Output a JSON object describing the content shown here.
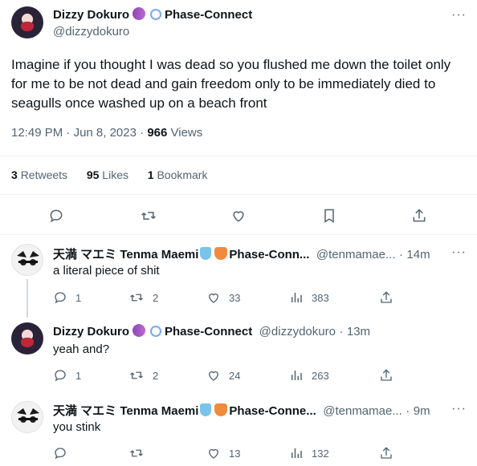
{
  "main_tweet": {
    "author_name": "Dizzy Dokuro",
    "affiliation": "Phase-Connect",
    "handle": "@dizzydokuro",
    "text": "Imagine if you thought I was dead so you flushed me down the toilet only for me to be not dead and gain freedom only to be immediately died to seagulls once washed up on a beach front",
    "time": "12:49 PM",
    "date": "Jun 8, 2023",
    "views_count": "966",
    "views_label": "Views",
    "retweets_count": "3",
    "retweets_label": "Retweets",
    "likes_count": "95",
    "likes_label": "Likes",
    "bookmarks_count": "1",
    "bookmarks_label": "Bookmark",
    "more": "···",
    "separator": "·"
  },
  "replies": [
    {
      "author_name": "天満 マエミ Tenma Maemi",
      "affiliation": "Phase-Conn...",
      "handle": "@tenmamae...",
      "time": "14m",
      "text": "a literal piece of shit",
      "replies": "1",
      "retweets": "2",
      "likes": "33",
      "views": "383"
    },
    {
      "author_name": "Dizzy Dokuro",
      "affiliation": "Phase-Connect",
      "handle": "@dizzydokuro",
      "time": "13m",
      "text": "yeah and?",
      "replies": "1",
      "retweets": "2",
      "likes": "24",
      "views": "263"
    },
    {
      "author_name": "天満 マエミ Tenma Maemi",
      "affiliation": "Phase-Conne...",
      "handle": "@tenmamae...",
      "time": "9m",
      "text": "you stink",
      "replies": "",
      "retweets": "",
      "likes": "13",
      "views": "132"
    }
  ],
  "colors": {
    "text": "#0f1419",
    "muted": "#536471",
    "divider": "#eff3f4",
    "thread_line": "#cfd9de"
  },
  "icons": [
    "reply-icon",
    "retweet-icon",
    "like-icon",
    "bookmark-icon",
    "share-icon",
    "views-icon",
    "more-icon"
  ]
}
